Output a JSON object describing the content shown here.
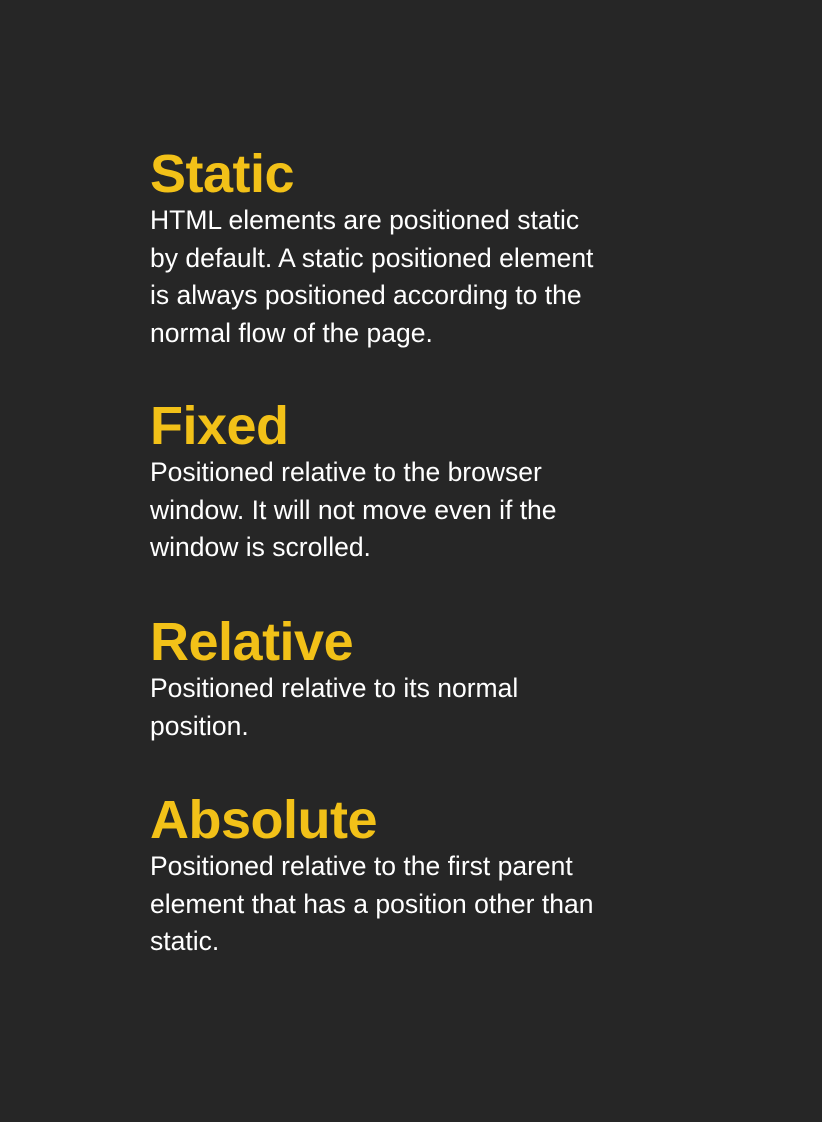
{
  "sections": [
    {
      "title": "Static",
      "body": "HTML elements are positioned static\nby default. A static positioned element\nis always positioned according to the\nnormal flow of the page."
    },
    {
      "title": "Fixed",
      "body": "Positioned relative to the browser\nwindow. It will not move even if the\nwindow is scrolled."
    },
    {
      "title": "Relative",
      "body": "Positioned relative to its normal\nposition."
    },
    {
      "title": "Absolute",
      "body": "Positioned relative to the first parent\nelement that has a position other than\nstatic."
    }
  ],
  "colors": {
    "background": "#262626",
    "heading": "#f2c118",
    "body_text": "#ffffff"
  }
}
